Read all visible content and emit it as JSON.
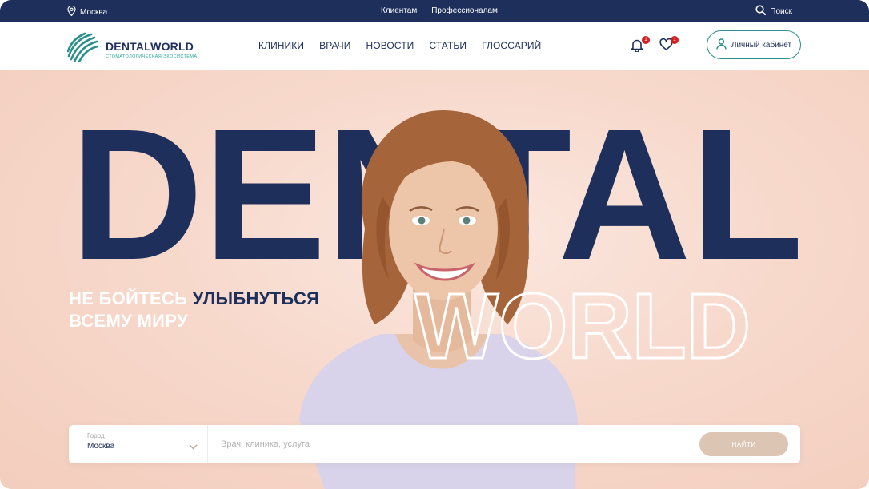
{
  "topbar": {
    "city": "Москва",
    "links": [
      "Клиентам",
      "Профессионалам"
    ],
    "search_label": "Поиск"
  },
  "header": {
    "logo_name": "DENTALWORLD",
    "logo_tagline": "СТОМАТОЛОГИЧЕСКАЯ ЭКОСИСТЕМА",
    "nav": [
      "КЛИНИКИ",
      "ВРАЧИ",
      "НОВОСТИ",
      "СТАТЬИ",
      "ГЛОССАРИЙ"
    ],
    "notifications_count": "1",
    "favorites_count": "1",
    "cabinet_label": "Личный кабинет"
  },
  "hero": {
    "title_top": "DENTAL",
    "title_bottom": "WORLD",
    "slogan_line1_plain": "НЕ БОЙТЕСЬ ",
    "slogan_line1_accent": "УЛЫБНУТЬСЯ",
    "slogan_line2": "ВСЕМУ МИРУ"
  },
  "search": {
    "city_label": "Город",
    "city_value": "Москва",
    "query_placeholder": "Врач, клиника, услуга",
    "query_value": "",
    "button_label": "НАЙТИ"
  },
  "colors": {
    "navy": "#1e2f5c",
    "teal": "#2a8f8a",
    "peach": "#f7d9cc",
    "button": "#dcc5b3",
    "badge": "#d32020"
  },
  "icons": [
    "location-pin-icon",
    "search-icon",
    "logo-mark-icon",
    "bell-icon",
    "heart-icon",
    "user-icon",
    "chevron-down-icon"
  ]
}
